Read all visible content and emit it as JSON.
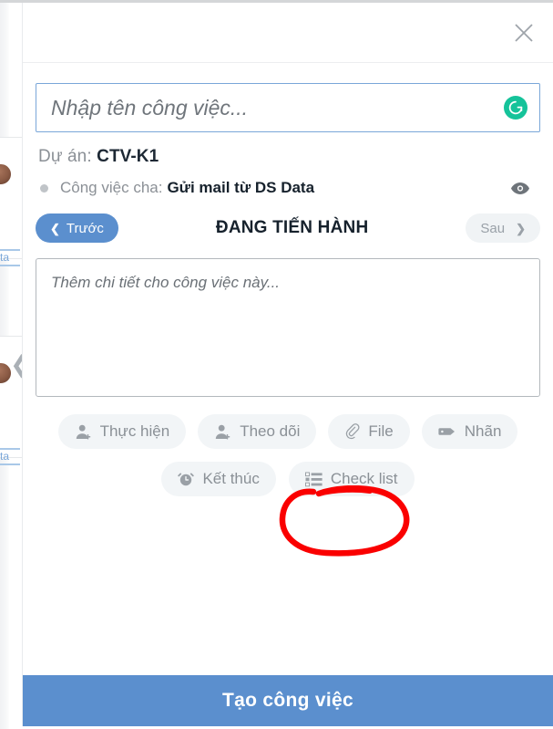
{
  "window": {
    "close_icon": "close-icon"
  },
  "task_title_input": {
    "value": "",
    "placeholder": "Nhập tên công việc...",
    "assistant_badge": "grammarly-icon",
    "assistant_badge_letter": "G",
    "border_color": "#7aa7d9"
  },
  "project": {
    "label": "Dự án:",
    "value": "CTV-K1"
  },
  "parent_task": {
    "label": "Công việc cha:",
    "value": "Gửi mail từ DS Data",
    "visibility_icon": "eye-icon"
  },
  "status_nav": {
    "prev_label": "Trước",
    "prev_icon": "chevron-left-icon",
    "current_status": "ĐANG TIẾN HÀNH",
    "next_label": "Sau",
    "next_icon": "chevron-right-icon",
    "prev_color": "#5b8fce",
    "next_color": "#f0f3f5"
  },
  "description_input": {
    "value": "",
    "placeholder": "Thêm chi tiết cho công việc này..."
  },
  "action_chips": {
    "row1": [
      {
        "label": "Thực hiện",
        "icon": "user-add-icon"
      },
      {
        "label": "Theo dõi",
        "icon": "user-follow-icon"
      },
      {
        "label": "File",
        "icon": "paperclip-icon"
      },
      {
        "label": "Nhãn",
        "icon": "tag-icon"
      }
    ],
    "row2": [
      {
        "label": "Kết thúc",
        "icon": "alarm-clock-icon"
      },
      {
        "label": "Check list",
        "icon": "checklist-icon"
      }
    ]
  },
  "submit": {
    "label": "Tạo công việc",
    "color": "#5b8fce"
  },
  "annotation": {
    "shape": "hand-drawn-ellipse",
    "color": "#fa0000",
    "target": "Check list"
  },
  "background": {
    "carousel_prev_icon": "chevron-left-icon",
    "link_fragment": "ta"
  }
}
